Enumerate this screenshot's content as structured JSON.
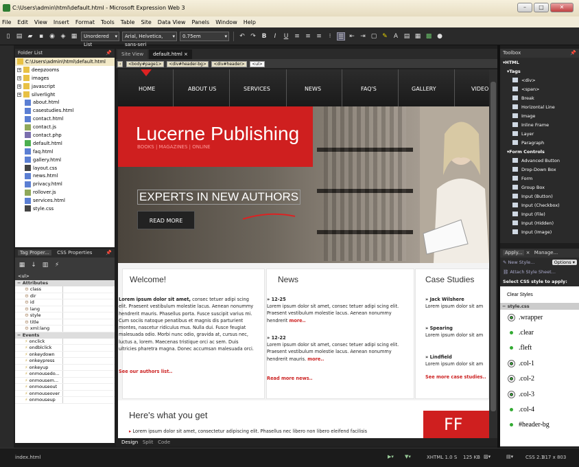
{
  "window": {
    "title": "C:\\Users\\admin\\html\\default.html - Microsoft Expression Web 3"
  },
  "menu": [
    "File",
    "Edit",
    "View",
    "Insert",
    "Format",
    "Tools",
    "Table",
    "Site",
    "Data View",
    "Panels",
    "Window",
    "Help"
  ],
  "toolbar": {
    "style_select": "Unordered List",
    "font_select": "Arial, Helvetica, sans-seri",
    "size_select": "0.75em"
  },
  "folder_list": {
    "title": "Folder List",
    "root": "C:\\Users\\admin\\html\\default.html",
    "folders": [
      "deepzooms",
      "images",
      "javascript",
      "silverlight"
    ],
    "files": [
      "about.html",
      "casestudies.html",
      "contact.html",
      "contact.js",
      "contact.php",
      "default.html",
      "faq.html",
      "gallery.html",
      "layout.css",
      "news.html",
      "privacy.html",
      "rollover.js",
      "services.html",
      "style.css"
    ]
  },
  "tag_panel": {
    "tab1": "Tag Proper...",
    "tab2": "CSS Properties",
    "tag": "<ul>",
    "attributes_label": "Attributes",
    "attributes": [
      "class",
      "dir",
      "id",
      "lang",
      "style",
      "title",
      "xml:lang"
    ],
    "events_label": "Events",
    "events": [
      "onclick",
      "ondblclick",
      "onkeydown",
      "onkeypress",
      "onkeyup",
      "onmousedo...",
      "onmousem...",
      "onmouseout",
      "onmouseover",
      "onmouseup"
    ]
  },
  "doc_tabs": {
    "site_view": "Site View",
    "active": "default.html"
  },
  "breadcrumb": [
    "<body#page1>",
    "<div#header-bg>",
    "<div#header>",
    "<ul>"
  ],
  "site": {
    "nav": [
      "HOME",
      "ABOUT US",
      "SERVICES",
      "NEWS",
      "FAQ'S",
      "GALLERY",
      "VIDEO"
    ],
    "brand": "Lucerne Publishing",
    "brand_sub": "BOOKS  |  MAGAZINES  |  ONLINE",
    "experts": "EXPERTS IN NEW AUTHORS",
    "read_more": "READ MORE",
    "welcome": {
      "title": "Welcome!",
      "lead": "Lorem ipsum dolor sit amet,",
      "body": " consec tetuer adipi scing elit. Praesent vestibulum molestie lacus. Aenean nonummy hendrerit mauris. Phasellus porta. Fusce suscipit varius mi. Cum sociis natoque penatibus et magnis dis parturient montes, nascetur ridiculus mus. Nulla dui. Fusce feugiat malesuada odio. Morbi nunc odio, gravida at, cursus nec, luctus a, lorem. Maecenas tristique orci ac sem. Duis ultricies pharetra magna. Donec accumsan malesuada orci.",
      "link": "See our authors list.."
    },
    "news": {
      "title": "News",
      "d1": "12-25",
      "t1": "Lorem ipsum dolor sit amet, consec tetuer adipi scing elit. Praesent vestibulum molestie lacus. Aenean nonummy hendrerit",
      "more": "more..",
      "d2": "12-22",
      "t2": "Lorem ipsum dolor sit amet, consec tetuer adipi scing elit. Praesent vestibulum molestie lacus. Aenean nonummy hendrerit mauris.",
      "link": "Read more news.."
    },
    "cases": {
      "title": "Case Studies",
      "n1": "Jack Wilshere",
      "n2": "Spearing",
      "n3": "Lindfield",
      "txt": "Lorem ipsum dolor sit am",
      "link": "See more case studies.."
    },
    "here_title": "Here's what you get",
    "here_text": "Lorem ipsum dolor sit amet, consectetur adipiscing elit. Phasellus nec libero non libero eleifend facilisis",
    "ff": "FF"
  },
  "view_tabs": [
    "Design",
    "Split",
    "Code"
  ],
  "toolbox": {
    "title": "Toolbox",
    "html": "HTML",
    "tags_label": "Tags",
    "tags": [
      "<div>",
      "<span>",
      "Break",
      "Horizontal Line",
      "Image",
      "Inline Frame",
      "Layer",
      "Paragraph"
    ],
    "forms_label": "Form Controls",
    "forms": [
      "Advanced Button",
      "Drop-Down Box",
      "Form",
      "Group Box",
      "Input (Button)",
      "Input (Checkbox)",
      "Input (File)",
      "Input (Hidden)",
      "Input (Image)"
    ]
  },
  "styles_panel": {
    "tab1": "Apply...",
    "tab2": "Manage...",
    "new_style": "New Style...",
    "options": "Options",
    "attach": "Attach Style Sheet...",
    "select_label": "Select CSS style to apply:",
    "clear": "Clear Styles",
    "sheet": "style.css",
    "styles": [
      ".wrapper",
      ".clear",
      ".fleft",
      ".col-1",
      ".col-2",
      ".col-3",
      ".col-4",
      "#header-bg"
    ]
  },
  "status": {
    "file": "index.html",
    "doctype": "XHTML 1.0 S",
    "size": "125 KB",
    "css": "CSS 2.1",
    "dims": "817 x 803"
  }
}
